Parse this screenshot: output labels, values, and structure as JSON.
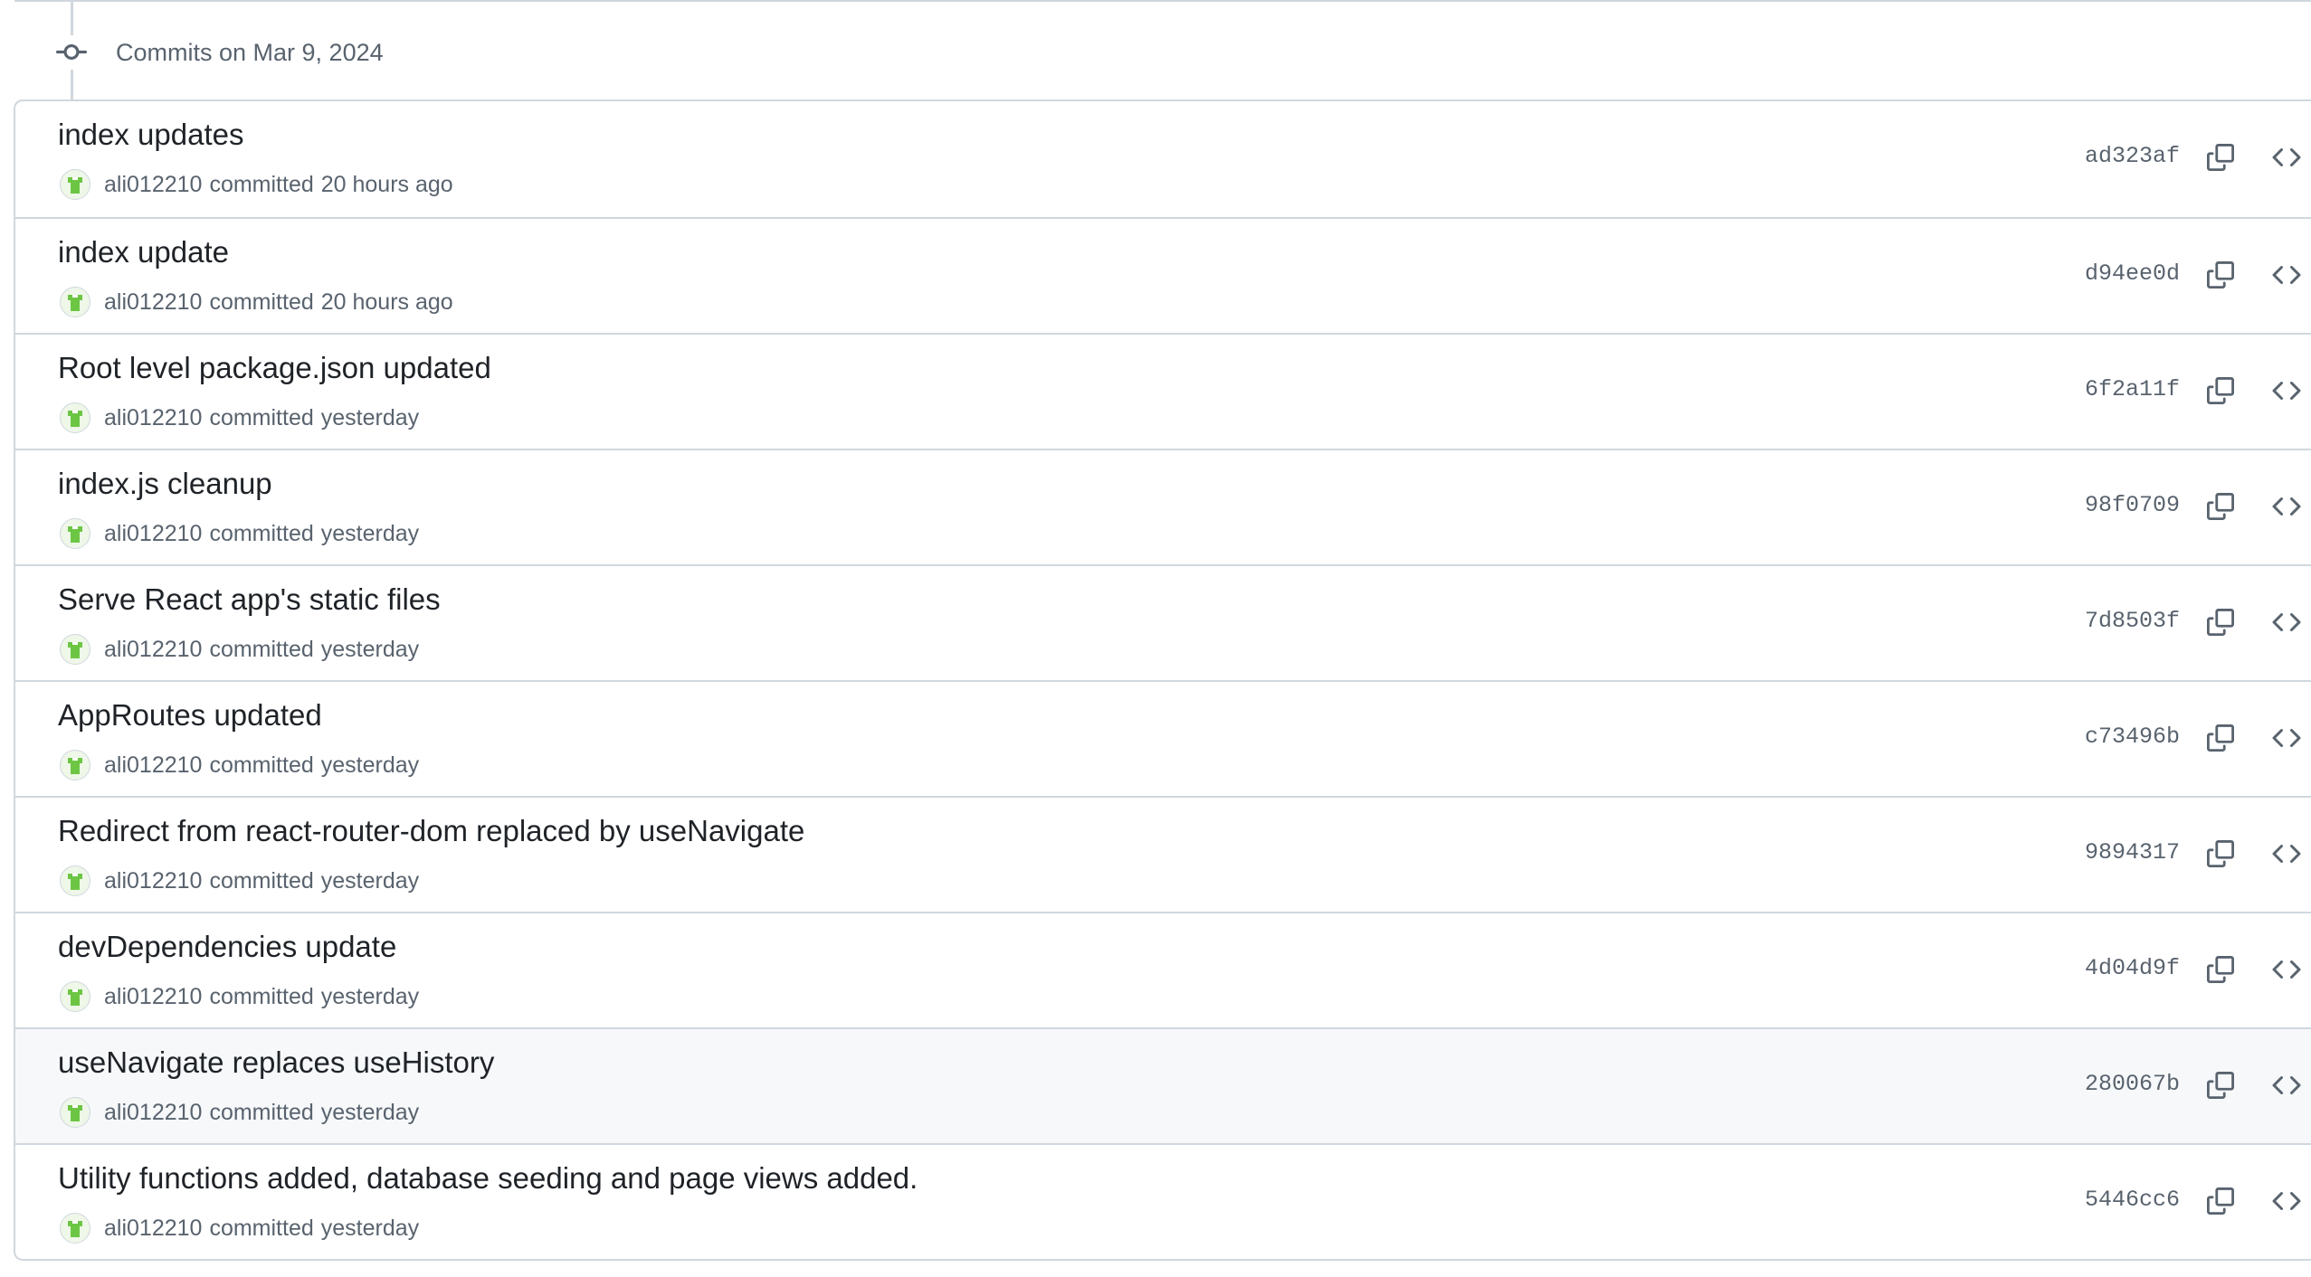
{
  "group": {
    "title": "Commits on Mar 9, 2024",
    "icon": "git-commit-icon"
  },
  "colors": {
    "border": "#d0d7de",
    "muted_text": "#59636e",
    "primary_text": "#1f2328",
    "hover_row": "#f6f8fa",
    "avatar_green": "#6cc644"
  },
  "committed_label": "committed",
  "commits": [
    {
      "title": "index updates",
      "author": "ali012210",
      "time": "20 hours ago",
      "sha": "ad323af"
    },
    {
      "title": "index update",
      "author": "ali012210",
      "time": "20 hours ago",
      "sha": "d94ee0d"
    },
    {
      "title": "Root level package.json updated",
      "author": "ali012210",
      "time": "yesterday",
      "sha": "6f2a11f"
    },
    {
      "title": "index.js cleanup",
      "author": "ali012210",
      "time": "yesterday",
      "sha": "98f0709"
    },
    {
      "title": "Serve React app's static files",
      "author": "ali012210",
      "time": "yesterday",
      "sha": "7d8503f"
    },
    {
      "title": "AppRoutes updated",
      "author": "ali012210",
      "time": "yesterday",
      "sha": "c73496b"
    },
    {
      "title": "Redirect from react-router-dom replaced by useNavigate",
      "author": "ali012210",
      "time": "yesterday",
      "sha": "9894317"
    },
    {
      "title": "devDependencies update",
      "author": "ali012210",
      "time": "yesterday",
      "sha": "4d04d9f"
    },
    {
      "title": "useNavigate replaces useHistory",
      "author": "ali012210",
      "time": "yesterday",
      "sha": "280067b"
    },
    {
      "title": "Utility functions added, database seeding and page views added.",
      "author": "ali012210",
      "time": "yesterday",
      "sha": "5446cc6"
    }
  ]
}
